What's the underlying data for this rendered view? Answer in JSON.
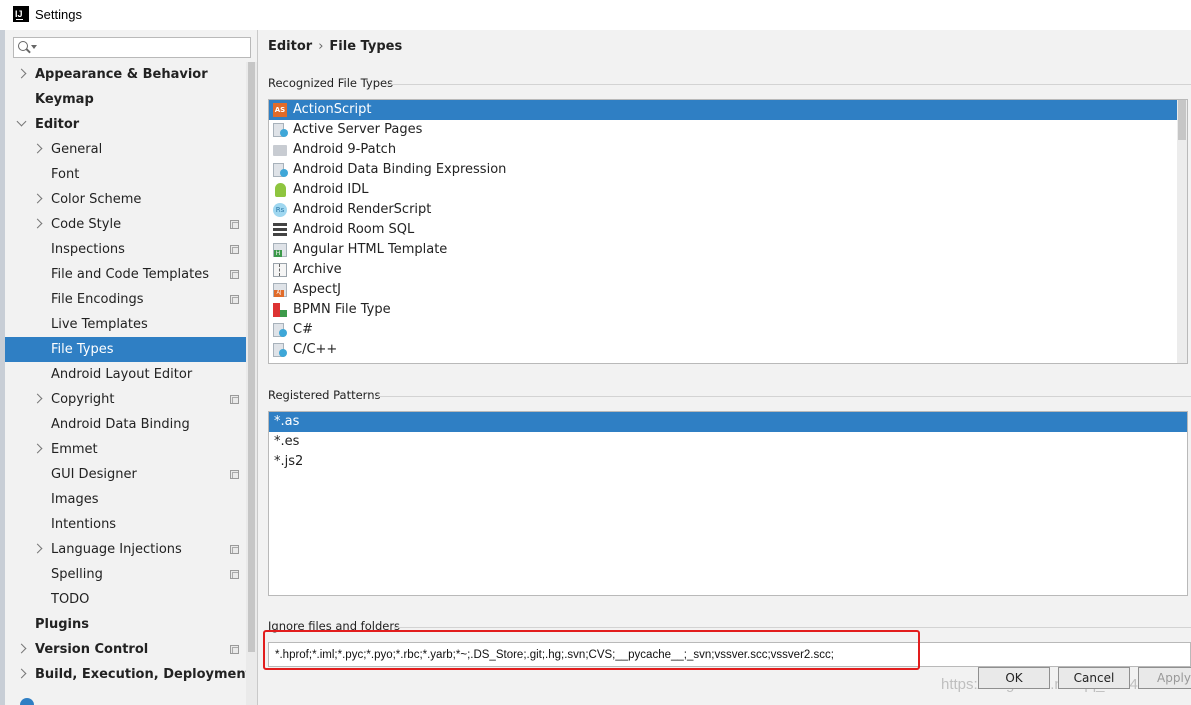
{
  "window": {
    "title": "Settings",
    "logo": "IJ"
  },
  "search": {
    "value": "",
    "placeholder": ""
  },
  "sidebar": {
    "items": [
      {
        "label": "Appearance & Behavior",
        "level": 0,
        "arrow": "right",
        "project": false,
        "selected": false
      },
      {
        "label": "Keymap",
        "level": 0,
        "arrow": "none",
        "project": false,
        "selected": false
      },
      {
        "label": "Editor",
        "level": 0,
        "arrow": "down",
        "project": false,
        "selected": false
      },
      {
        "label": "General",
        "level": 1,
        "arrow": "right",
        "project": false,
        "selected": false
      },
      {
        "label": "Font",
        "level": 1,
        "arrow": "none",
        "project": false,
        "selected": false
      },
      {
        "label": "Color Scheme",
        "level": 1,
        "arrow": "right",
        "project": false,
        "selected": false
      },
      {
        "label": "Code Style",
        "level": 1,
        "arrow": "right",
        "project": true,
        "selected": false
      },
      {
        "label": "Inspections",
        "level": 1,
        "arrow": "none",
        "project": true,
        "selected": false
      },
      {
        "label": "File and Code Templates",
        "level": 1,
        "arrow": "none",
        "project": true,
        "selected": false
      },
      {
        "label": "File Encodings",
        "level": 1,
        "arrow": "none",
        "project": true,
        "selected": false
      },
      {
        "label": "Live Templates",
        "level": 1,
        "arrow": "none",
        "project": false,
        "selected": false
      },
      {
        "label": "File Types",
        "level": 1,
        "arrow": "none",
        "project": false,
        "selected": true
      },
      {
        "label": "Android Layout Editor",
        "level": 1,
        "arrow": "none",
        "project": false,
        "selected": false
      },
      {
        "label": "Copyright",
        "level": 1,
        "arrow": "right",
        "project": true,
        "selected": false
      },
      {
        "label": "Android Data Binding",
        "level": 1,
        "arrow": "none",
        "project": false,
        "selected": false
      },
      {
        "label": "Emmet",
        "level": 1,
        "arrow": "right",
        "project": false,
        "selected": false
      },
      {
        "label": "GUI Designer",
        "level": 1,
        "arrow": "none",
        "project": true,
        "selected": false
      },
      {
        "label": "Images",
        "level": 1,
        "arrow": "none",
        "project": false,
        "selected": false
      },
      {
        "label": "Intentions",
        "level": 1,
        "arrow": "none",
        "project": false,
        "selected": false
      },
      {
        "label": "Language Injections",
        "level": 1,
        "arrow": "right",
        "project": true,
        "selected": false
      },
      {
        "label": "Spelling",
        "level": 1,
        "arrow": "none",
        "project": true,
        "selected": false
      },
      {
        "label": "TODO",
        "level": 1,
        "arrow": "none",
        "project": false,
        "selected": false
      },
      {
        "label": "Plugins",
        "level": 0,
        "arrow": "none",
        "project": false,
        "selected": false
      },
      {
        "label": "Version Control",
        "level": 0,
        "arrow": "right",
        "project": true,
        "selected": false
      },
      {
        "label": "Build, Execution, Deployment",
        "level": 0,
        "arrow": "right",
        "project": false,
        "selected": false
      }
    ]
  },
  "breadcrumb": {
    "parent": "Editor",
    "separator": "›",
    "current": "File Types"
  },
  "recognized": {
    "label": "Recognized File Types",
    "items": [
      {
        "label": "ActionScript",
        "icon": "as",
        "selected": true
      },
      {
        "label": "Active Server Pages",
        "icon": "asp",
        "selected": false
      },
      {
        "label": "Android 9-Patch",
        "icon": "folder",
        "selected": false
      },
      {
        "label": "Android Data Binding Expression",
        "icon": "adb",
        "selected": false
      },
      {
        "label": "Android IDL",
        "icon": "android",
        "selected": false
      },
      {
        "label": "Android RenderScript",
        "icon": "rs",
        "selected": false
      },
      {
        "label": "Android Room SQL",
        "icon": "room",
        "selected": false
      },
      {
        "label": "Angular HTML Template",
        "icon": "html",
        "selected": false
      },
      {
        "label": "Archive",
        "icon": "archive",
        "selected": false
      },
      {
        "label": "AspectJ",
        "icon": "aj",
        "selected": false
      },
      {
        "label": "BPMN File Type",
        "icon": "bpmn",
        "selected": false
      },
      {
        "label": "C#",
        "icon": "cs",
        "selected": false
      },
      {
        "label": "C/C++",
        "icon": "cpp",
        "selected": false
      }
    ]
  },
  "patterns": {
    "label": "Registered Patterns",
    "items": [
      {
        "label": "*.as",
        "selected": true
      },
      {
        "label": "*.es",
        "selected": false
      },
      {
        "label": "*.js2",
        "selected": false
      }
    ]
  },
  "ignore": {
    "label": "Ignore files and folders",
    "value": "*.hprof;*.iml;*.pyc;*.pyo;*.rbc;*.yarb;*~;.DS_Store;.git;.hg;.svn;CVS;__pycache__;_svn;vssver.scc;vssver2.scc;"
  },
  "watermark": "https://blog.csdn.net/qq_43143143",
  "buttons": {
    "ok": "OK",
    "cancel": "Cancel",
    "apply": "Apply"
  },
  "colors": {
    "selection": "#2f7fc4",
    "highlight_box": "#e21d1d"
  }
}
